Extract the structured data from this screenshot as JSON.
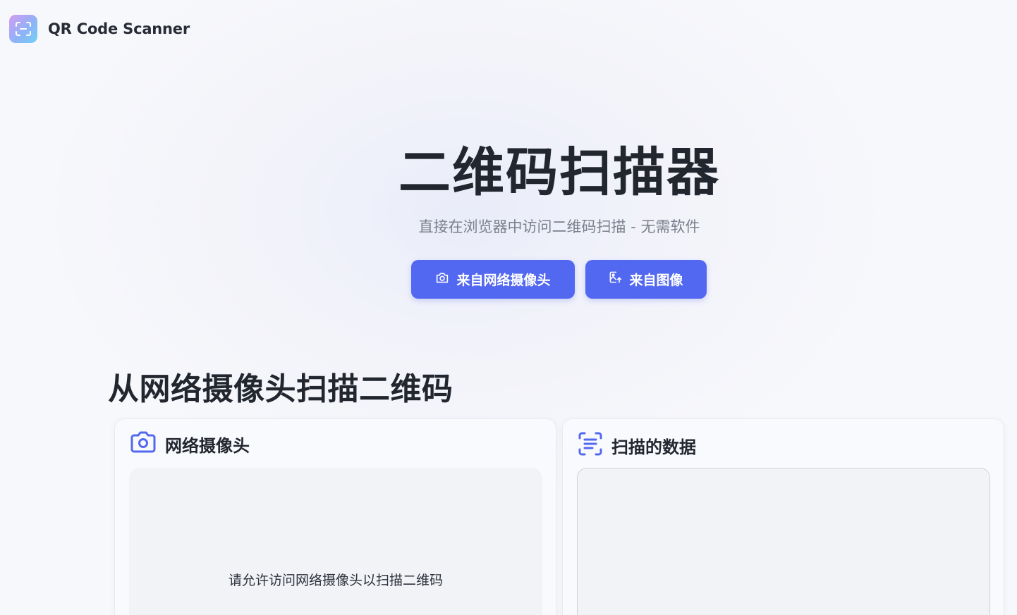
{
  "header": {
    "app_name": "QR Code Scanner",
    "logo_icon": "scan-icon"
  },
  "hero": {
    "title": "二维码扫描器",
    "subtitle": "直接在浏览器中访问二维码扫描 - 无需软件",
    "buttons": [
      {
        "label": "来自网络摄像头",
        "icon": "camera-icon"
      },
      {
        "label": "来自图像",
        "icon": "image-upload-icon"
      }
    ]
  },
  "section": {
    "title": "从网络摄像头扫描二维码"
  },
  "webcam_card": {
    "title": "网络摄像头",
    "icon": "camera-icon",
    "message": "请允许访问网络摄像头以扫描二维码"
  },
  "data_card": {
    "title": "扫描的数据",
    "icon": "scan-text-icon",
    "value": ""
  },
  "colors": {
    "accent": "#5368f0",
    "heading": "#22262f",
    "muted": "#7a7f8b"
  }
}
